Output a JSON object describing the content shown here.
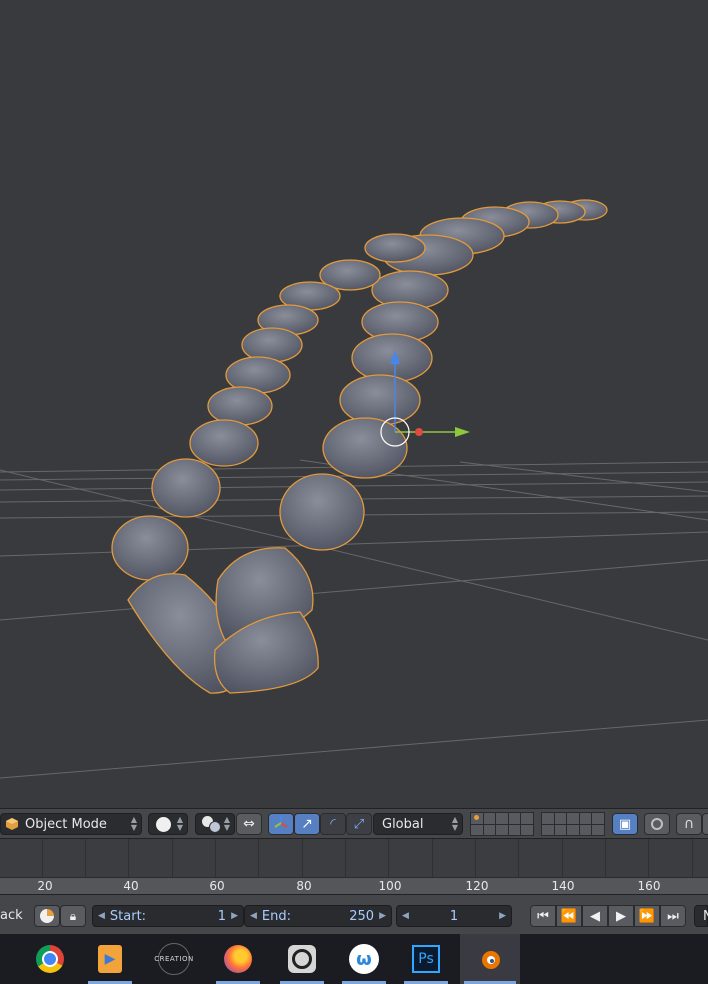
{
  "header": {
    "mode_label": "Object Mode",
    "orientation_label": "Global"
  },
  "timeline": {
    "ticks": [
      "20",
      "40",
      "60",
      "80",
      "100",
      "120",
      "140",
      "160"
    ]
  },
  "playback": {
    "left_cut_label": "ack",
    "start_label": "Start:",
    "start_value": "1",
    "end_label": "End:",
    "end_value": "250",
    "current_frame": "1",
    "right_cut_label": "N"
  },
  "taskbar": {
    "apps": [
      "chrome-icon",
      "video-player-icon",
      "creation-icon",
      "firefox-icon",
      "app-icon",
      "wunderlist-icon",
      "photoshop-icon",
      "blender-icon"
    ],
    "creation_text": "CREATION",
    "ps_text": "Ps"
  },
  "colors": {
    "viewport_bg": "#393a3d",
    "selection_outline": "#e39a3c",
    "active_button": "#5680c2",
    "gizmo_z": "#4a86e8",
    "gizmo_y": "#8dc63f",
    "gizmo_x": "#e04a3f"
  }
}
